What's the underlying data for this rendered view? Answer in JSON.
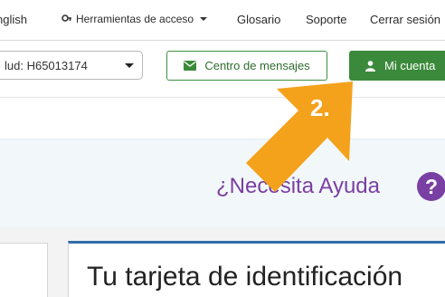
{
  "topbar": {
    "language": "nglish",
    "tools": "Herramientas de acceso",
    "glossary": "Glosario",
    "support": "Soporte",
    "logout": "Cerrar sesión"
  },
  "navbar": {
    "member_select_value": "lud: H65013174",
    "messages_label": "Centro de mensajes",
    "account_label": "Mi cuenta"
  },
  "help": {
    "text": "¿Necesita Ayuda"
  },
  "card": {
    "title": "Tu tarjeta de identificación"
  },
  "annotation": {
    "step": "2."
  },
  "colors": {
    "green": "#3b8a3b",
    "purple": "#7a3fa3",
    "arrow_orange": "#f4a21c",
    "card_border_blue": "#2f6ea8"
  },
  "icons": {
    "tools": "key-icon",
    "messages": "envelope-icon",
    "account": "user-icon",
    "help": "question-circle-icon"
  }
}
